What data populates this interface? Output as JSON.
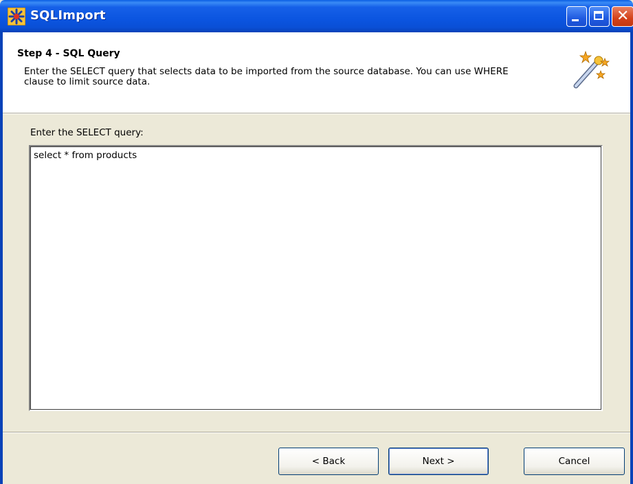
{
  "window": {
    "title": "SQLImport"
  },
  "header": {
    "step_title": "Step 4 - SQL Query",
    "description": "Enter the SELECT query that selects data to be imported from the source database. You can use WHERE clause to limit source data."
  },
  "query": {
    "label": "Enter the SELECT query:",
    "value": "select * from products"
  },
  "buttons": {
    "back": "< Back",
    "next": "Next >",
    "cancel": "Cancel"
  },
  "icons": {
    "app": "sqlimport-app-icon",
    "wizard": "magic-wand-icon"
  },
  "colors": {
    "titlebar": "#0a55e0",
    "background": "#ece9d8",
    "close_button": "#d4411a"
  }
}
